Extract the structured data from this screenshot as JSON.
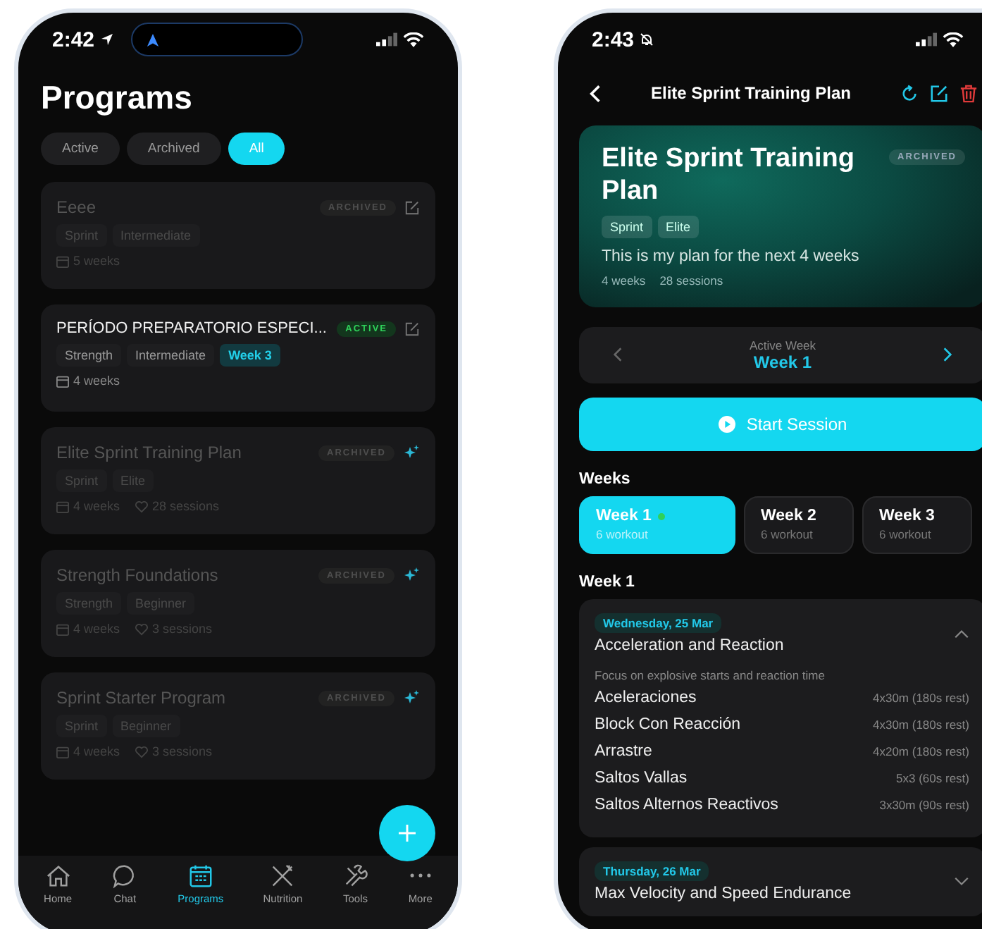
{
  "programs_screen": {
    "status_bar": {
      "time": "2:42"
    },
    "title": "Programs",
    "filters": [
      {
        "label": "Active",
        "selected": false
      },
      {
        "label": "Archived",
        "selected": false
      },
      {
        "label": "All",
        "selected": true
      }
    ],
    "programs": [
      {
        "title": "Eeee",
        "active": false,
        "badge": "ARCHIVED",
        "ai_generated": false,
        "tags": [
          {
            "label": "Sprint",
            "highlight": false
          },
          {
            "label": "Intermediate",
            "highlight": false
          }
        ],
        "weeks": "5 weeks"
      },
      {
        "title": "PERÍODO PREPARATORIO ESPECI...",
        "active": true,
        "badge": "ACTIVE",
        "ai_generated": false,
        "tags": [
          {
            "label": "Strength",
            "highlight": false
          },
          {
            "label": "Intermediate",
            "highlight": false
          },
          {
            "label": "Week 3",
            "highlight": true
          }
        ],
        "weeks": "4 weeks"
      },
      {
        "title": "Elite Sprint Training Plan",
        "active": false,
        "badge": "ARCHIVED",
        "ai_generated": true,
        "tags": [
          {
            "label": "Sprint",
            "highlight": false
          },
          {
            "label": "Elite",
            "highlight": false
          }
        ],
        "weeks": "4 weeks",
        "sessions": "28 sessions"
      },
      {
        "title": "Strength Foundations",
        "active": false,
        "badge": "ARCHIVED",
        "ai_generated": true,
        "tags": [
          {
            "label": "Strength",
            "highlight": false
          },
          {
            "label": "Beginner",
            "highlight": false
          }
        ],
        "weeks": "4 weeks",
        "sessions": "3 sessions"
      },
      {
        "title": "Sprint Starter Program",
        "active": false,
        "badge": "ARCHIVED",
        "ai_generated": true,
        "tags": [
          {
            "label": "Sprint",
            "highlight": false
          },
          {
            "label": "Beginner",
            "highlight": false
          }
        ],
        "weeks": "4 weeks",
        "sessions": "3 sessions"
      }
    ],
    "tab_bar": [
      {
        "label": "Home",
        "kind": "home",
        "selected": false
      },
      {
        "label": "Chat",
        "kind": "chat",
        "selected": false
      },
      {
        "label": "Programs",
        "kind": "calendar",
        "selected": true
      },
      {
        "label": "Nutrition",
        "kind": "utensils",
        "selected": false
      },
      {
        "label": "Tools",
        "kind": "tools",
        "selected": false
      },
      {
        "label": "More",
        "kind": "more",
        "selected": false
      }
    ]
  },
  "detail_screen": {
    "status_bar": {
      "time": "2:43"
    },
    "header": {
      "title": "Elite Sprint Training Plan"
    },
    "hero": {
      "title": "Elite Sprint Training Plan",
      "badge": "ARCHIVED",
      "tags": [
        "Sprint",
        "Elite"
      ],
      "description": "This is my plan for the next 4 weeks",
      "weeks": "4 weeks",
      "sessions": "28 sessions"
    },
    "active_week": {
      "label": "Active Week",
      "value": "Week 1",
      "prev_enabled": false,
      "next_enabled": true
    },
    "start_button": "Start Session",
    "weeks_heading": "Weeks",
    "weeks": [
      {
        "label": "Week 1",
        "sub": "6 workout",
        "selected": true,
        "current": true
      },
      {
        "label": "Week 2",
        "sub": "6 workout",
        "selected": false,
        "current": false
      },
      {
        "label": "Week 3",
        "sub": "6 workout",
        "selected": false,
        "current": false
      }
    ],
    "section_heading": "Week 1",
    "sessions": [
      {
        "date": "Wednesday, 25 Mar",
        "title": "Acceleration and Reaction",
        "expanded": true,
        "focus": "Focus on explosive starts and reaction time",
        "exercises": [
          {
            "name": "Aceleraciones",
            "detail": "4x30m (180s rest)"
          },
          {
            "name": "Block Con Reacción",
            "detail": "4x30m (180s rest)"
          },
          {
            "name": "Arrastre",
            "detail": "4x20m (180s rest)"
          },
          {
            "name": "Saltos Vallas",
            "detail": "5x3 (60s rest)"
          },
          {
            "name": "Saltos Alternos Reactivos",
            "detail": "3x30m (90s rest)"
          }
        ]
      },
      {
        "date": "Thursday, 26 Mar",
        "title": "Max Velocity and Speed Endurance",
        "expanded": false
      }
    ]
  }
}
